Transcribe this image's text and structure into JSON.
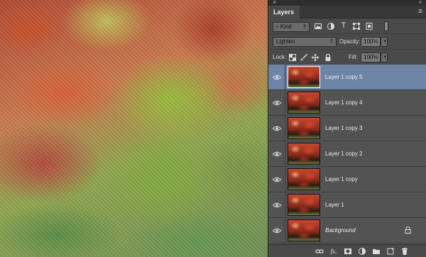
{
  "panel": {
    "close_glyph": "×",
    "collapse_glyph": "»",
    "tab_label": "Layers",
    "menu_glyph": "≡"
  },
  "filter": {
    "kind_label": "Kind",
    "icons": [
      "image-filter-icon",
      "adjustment-filter-icon",
      "type-filter-icon",
      "shape-filter-icon",
      "smart-object-filter-icon"
    ]
  },
  "blend": {
    "mode": "Lighten",
    "opacity_label": "Opacity:",
    "opacity_value": "100%"
  },
  "lock": {
    "label": "Lock:",
    "fill_label": "Fill:",
    "fill_value": "100%"
  },
  "layers": [
    {
      "name": "Layer 1 copy 5",
      "selected": true,
      "italic": false,
      "locked": false
    },
    {
      "name": "Layer 1 copy 4",
      "selected": false,
      "italic": false,
      "locked": false
    },
    {
      "name": "Layer 1 copy 3",
      "selected": false,
      "italic": false,
      "locked": false
    },
    {
      "name": "Layer 1 copy 2",
      "selected": false,
      "italic": false,
      "locked": false
    },
    {
      "name": "Layer 1 copy",
      "selected": false,
      "italic": false,
      "locked": false
    },
    {
      "name": "Layer 1",
      "selected": false,
      "italic": false,
      "locked": false
    },
    {
      "name": "Background",
      "selected": false,
      "italic": true,
      "locked": true
    }
  ],
  "colors": {
    "panel_bg": "#4a4a4a",
    "selected_layer": "#6e84a6",
    "layer_bg": "#535353"
  }
}
